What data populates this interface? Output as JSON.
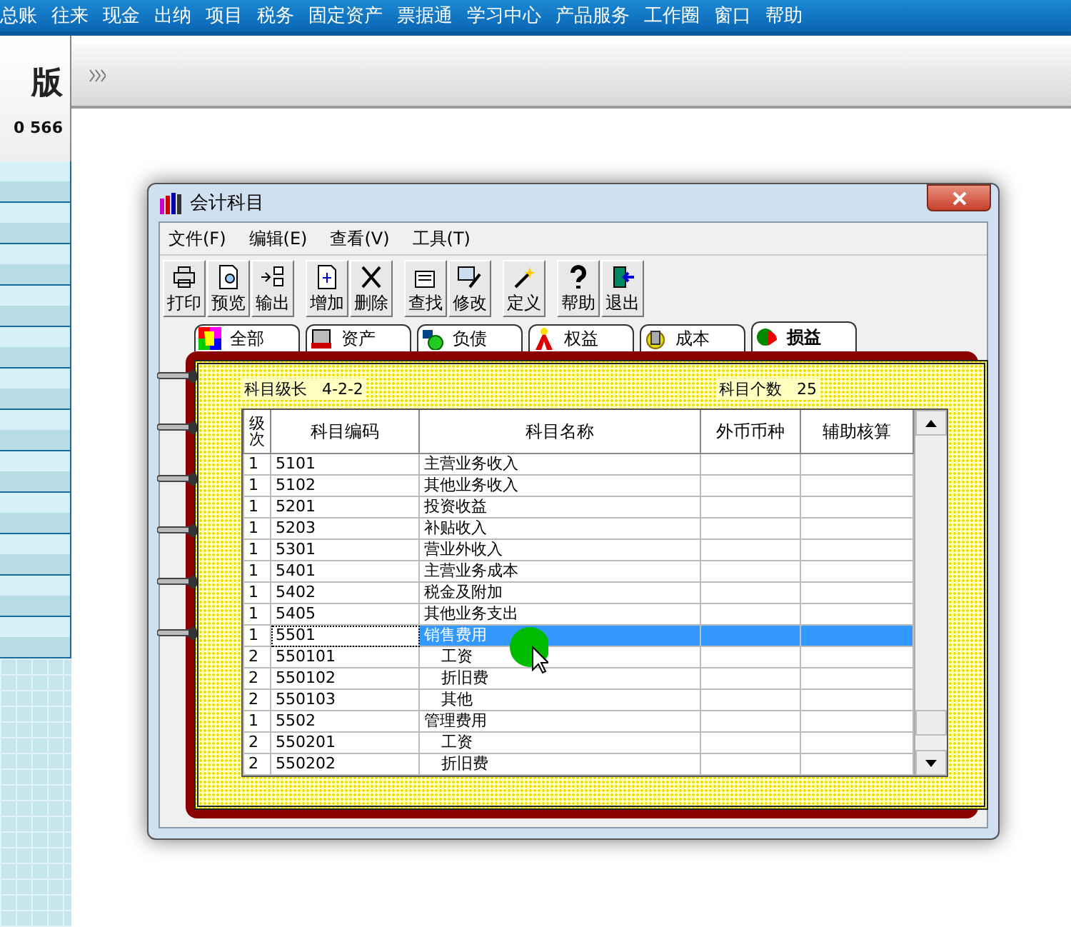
{
  "menubar": [
    "总账",
    "往来",
    "现金",
    "出纳",
    "项目",
    "税务",
    "固定资产",
    "票据通",
    "学习中心",
    "产品服务",
    "工作圈",
    "窗口",
    "帮助"
  ],
  "sidebar": {
    "edition": "版",
    "phone": "0 566"
  },
  "dialog": {
    "title": "会计科目",
    "menu": [
      "文件(F)",
      "编辑(E)",
      "查看(V)",
      "工具(T)"
    ],
    "toolbar": [
      [
        "打印",
        "预览",
        "输出"
      ],
      [
        "增加",
        "删除"
      ],
      [
        "查找",
        "修改"
      ],
      [
        "定义"
      ],
      [
        "帮助",
        "退出"
      ]
    ],
    "tabs": [
      {
        "label": "全部",
        "selected": false
      },
      {
        "label": "资产",
        "selected": false
      },
      {
        "label": "负债",
        "selected": false
      },
      {
        "label": "权益",
        "selected": false
      },
      {
        "label": "成本",
        "selected": false
      },
      {
        "label": "损益",
        "selected": true
      }
    ],
    "level_length": {
      "label": "科目级长",
      "value": "4-2-2"
    },
    "count": {
      "label": "科目个数",
      "value": "25"
    },
    "table": {
      "columns": [
        "级次",
        "科目编码",
        "科目名称",
        "外币币种",
        "辅助核算"
      ],
      "rows": [
        {
          "level": "1",
          "code": "5101",
          "name": "主营业务收入",
          "selected": false
        },
        {
          "level": "1",
          "code": "5102",
          "name": "其他业务收入",
          "selected": false
        },
        {
          "level": "1",
          "code": "5201",
          "name": "投资收益",
          "selected": false
        },
        {
          "level": "1",
          "code": "5203",
          "name": "补贴收入",
          "selected": false
        },
        {
          "level": "1",
          "code": "5301",
          "name": "营业外收入",
          "selected": false
        },
        {
          "level": "1",
          "code": "5401",
          "name": "主营业务成本",
          "selected": false
        },
        {
          "level": "1",
          "code": "5402",
          "name": "税金及附加",
          "selected": false
        },
        {
          "level": "1",
          "code": "5405",
          "name": "其他业务支出",
          "selected": false
        },
        {
          "level": "1",
          "code": "5501",
          "name": "销售费用",
          "selected": true,
          "children": [
            {
              "level": "2",
              "code": "550101",
              "name": "工资",
              "selected": false
            },
            {
              "level": "2",
              "code": "550102",
              "name": "折旧费",
              "selected": false
            },
            {
              "level": "2",
              "code": "550103",
              "name": "其他",
              "selected": false
            }
          ]
        },
        {
          "level": "1",
          "code": "5502",
          "name": "管理费用",
          "selected": false,
          "children": [
            {
              "level": "2",
              "code": "550201",
              "name": "工资",
              "selected": false
            },
            {
              "level": "2",
              "code": "550202",
              "name": "折旧费",
              "selected": false
            }
          ]
        }
      ]
    }
  }
}
